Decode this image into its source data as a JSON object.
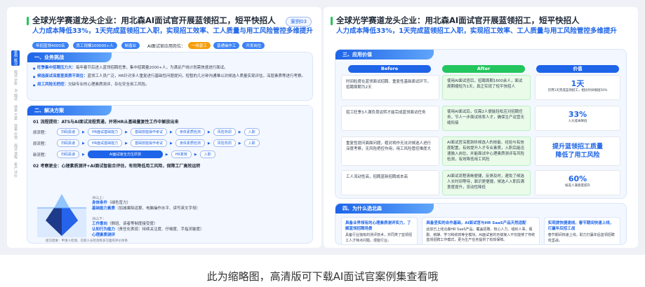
{
  "left": {
    "title": "全球光学赛道龙头企业：用北森AI面试官开展蓝领招工，短平快招人",
    "subtitle": "人力成本降低33%，1天完成蓝领招工入职，实现招工效率、工人质量与用工风险管控多维提升",
    "case_tag": "案例03",
    "chips": [
      "年招蓝领4000名",
      "员工规模100000+人",
      "制造业"
    ],
    "positions_label": "AI面试官应用岗位：",
    "positions": [
      "一线普工",
      "普通操作工",
      "开发岗位"
    ],
    "side_nav": [
      "案例 概况",
      "面试 对象",
      "AI 面试",
      "场景 方案",
      "效果 价值",
      "面试 流程",
      "客户 评价"
    ],
    "section1": {
      "title": "一、业务挑战",
      "bullets": [
        {
          "label": "旺季集中招聘压力大：",
          "text": "每年春节后进入蓝领招聘旺季，集中招聘量2000+人，为满足产线计划需快速进行面试。"
        },
        {
          "label": "候选面试深度差资质不到位：",
          "text": "蓝领工人员广泛，HR针对多人重复进行基础性问题提问，短暂的几分钟沟通难以对候选人质量实现评估，深层素质等进行考察。"
        },
        {
          "label": "用工风险无把控：",
          "text": "欠缺专业的心理素质测评，存在安全用工风险。"
        }
      ]
    },
    "section2": {
      "title": "二、解决方案",
      "flow_title": "01 流程提效：ATS与AI面试流程贯通，并将HR从基础量复性工作中解放出来",
      "flow_before_label": "原流程：",
      "flow_before": [
        "扫码投递",
        "HR面试基础能力",
        "基础技能操作考试",
        "身体素质检测",
        "风险背调",
        "入职"
      ],
      "flow_mid_label": "原流程：",
      "flow_mid": [
        "扫码投递",
        "HR面试基础能力",
        "基础技能操作考试",
        "身体素质检测",
        "风险背调",
        "入职"
      ],
      "flow_new_label": "新流程：",
      "flow_new": [
        "扫码投递",
        "AI面试官全方位评测",
        "HR复核",
        "入职"
      ],
      "assess_title": "02 考察更全：心理素质测评+AI面试智能合评估，有效降低用工风险，保障工厂高效运转",
      "above_label": "冰山上：",
      "above": [
        {
          "label": "身体条件",
          "text": "（绿色盲力）"
        },
        {
          "label": "基础能力素质",
          "text": "（加减乘除运算、电脑操作水平、读写英文字母）"
        }
      ],
      "below_label": "冰山下：",
      "below": [
        {
          "label": "工作意向",
          "text": "（倒班、该者等制度接受度）"
        },
        {
          "label": "认知行为能力",
          "text": "（责任化表现：持续关注度、仔细度、手指灵敏度）"
        },
        {
          "label": "心理素质测评",
          "text": ""
        }
      ],
      "footnote": "提交结果：申请人检测、在职人员检测等多方面的评价体系"
    }
  },
  "right": {
    "title": "全球光学赛道龙头企业：用北森AI面试官开展蓝领招工，短平快招人",
    "subtitle": "人力成本降低33%，1天完成蓝领招工入职，实现招工效率、工人质量与用工风险管控多维提升",
    "section3": {
      "title": "三、应用价值",
      "col_before": "Before",
      "col_after": "After",
      "col_value": "价值",
      "rows": [
        {
          "before": "时间粒度在蓝领面试招聘、重复性基础面试环节，招聘周期为2天",
          "after": "使用AI面试官后，招聘周期1600余人，面试周期缩短为1天，真正实现了短平快招人"
        },
        {
          "before": "招工旺季3人满负荷运转才能完成蓝领面试任务",
          "after": "使用AI面试后，仅需2人便能轻松应对招聘任务，节人一步面试效率人才，确保生产运营无缝衔接"
        },
        {
          "before": "重复性提问面面问题，粗对将作无法对候选人进行深度考察，无风险把控作用，用工风险管控难度大",
          "after": "AI面试官深度剖析候选人的技能、经验与有信度配置，有效提升人才专业素质，入职后能迅速融入岗位，并能面试中心理素质测评有风险检测，有效降低用工风险"
        },
        {
          "before": "工人流动性高，招聘蓝新招聘成本高",
          "after": "AI面试流程清晰便捷，反馈及时，避免了候选人长时间等待，面识更便捷，候选人入职后满意度提升，流动性降低"
        }
      ],
      "values": [
        {
          "big": "1天",
          "small": "仅用1天完成蓝领招工，相比时间缩短50%"
        },
        {
          "big": "33%",
          "small": "人力成本降低"
        },
        {
          "big": "提升蓝领招工质量\n降低了用工风险",
          "small": ""
        },
        {
          "big": "60%",
          "small": "候选人满意度提升"
        }
      ]
    },
    "section4": {
      "title": "四、为什么选北森",
      "items": [
        {
          "title": "具备业界领有的心理素质测评实力，了解蓝领招聘场景",
          "desc": "具备行业独有的测评技术，并同类了蓝领招工人才特点问题，便能行业。"
        },
        {
          "title": "具备坚实的合作基础，AI面试官与HR SaaS产品天然适配",
          "desc": "此前已上线北森HR SaaS产品，覆盖招聘、核心人力、组织人事、假勤、薪酬、学习和绩效等全模块。AI面试官的无缝接入不仅能够了传统蓝领招聘工作模式，更为生产任务提供了有效保障。"
        },
        {
          "title": "实现提快捷速线，春节期间快速上线，打赢年后招工战",
          "desc": "春节期间快速上线，助力打赢年后蓝领招聘攻坚战。"
        }
      ]
    }
  },
  "caption": "此为缩略图，高清版可下载AI面试官案例集查看哦"
}
